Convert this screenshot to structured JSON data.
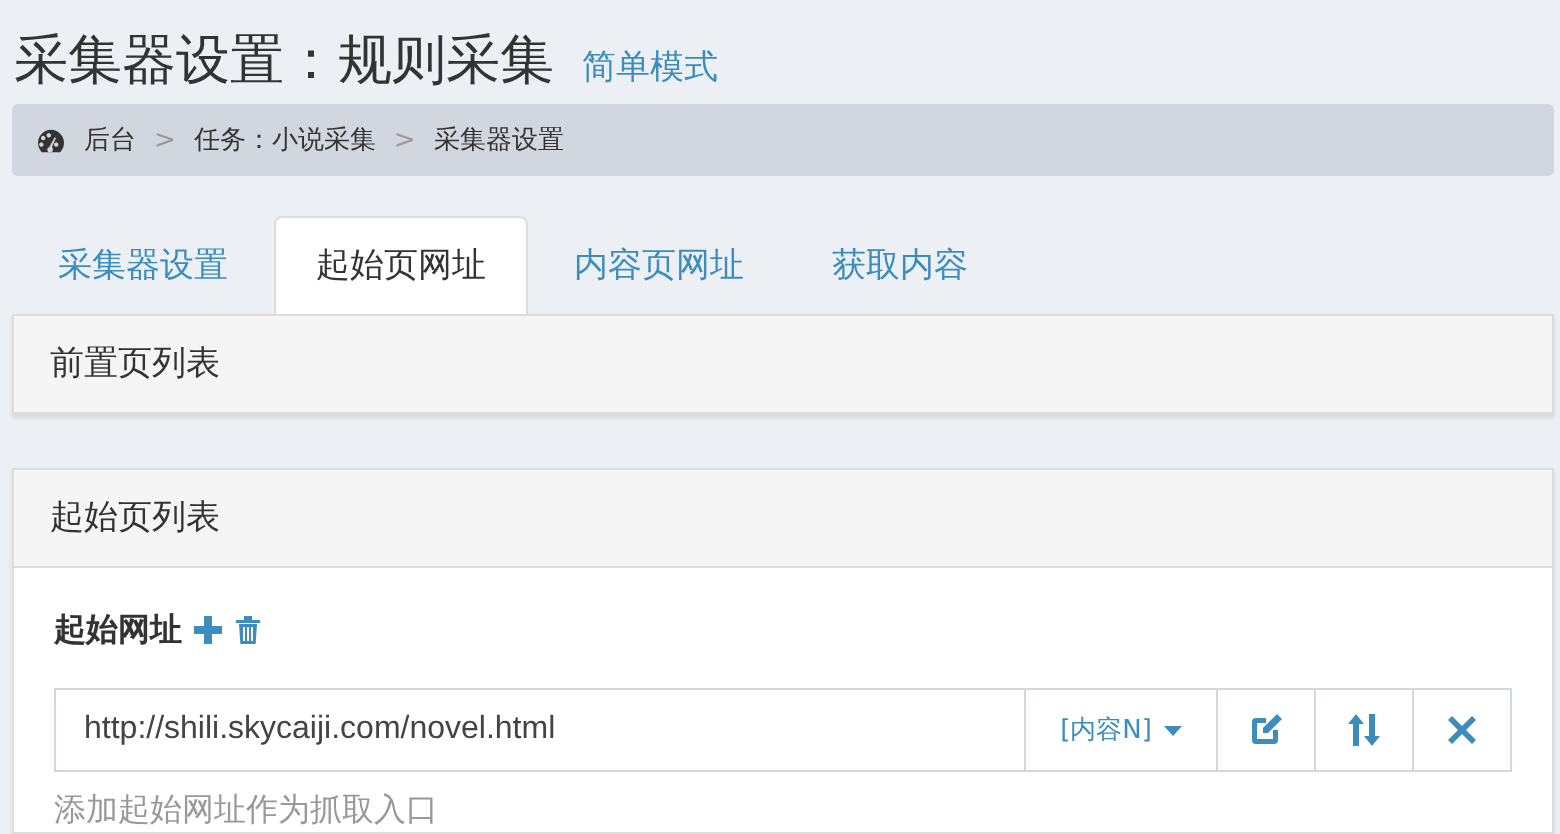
{
  "title": "采集器设置：规则采集",
  "mode_link": "简单模式",
  "breadcrumb": [
    {
      "label": "后台",
      "kind": "home"
    },
    {
      "label": "任务：小说采集",
      "kind": "link"
    },
    {
      "label": "采集器设置",
      "kind": "current"
    }
  ],
  "separator": ">",
  "tabs": [
    {
      "label": "采集器设置",
      "selected": false
    },
    {
      "label": "起始页网址",
      "selected": true
    },
    {
      "label": "内容页网址",
      "selected": false
    },
    {
      "label": "获取内容",
      "selected": false
    }
  ],
  "panels": [
    {
      "heading": "前置页列表"
    },
    {
      "heading": "起始页列表"
    }
  ],
  "start_url": {
    "label": "起始网址",
    "value": "http://shili.skycaiji.com/novel.html",
    "dropdown": "[内容N]",
    "hint": "添加起始网址作为抓取入口"
  }
}
